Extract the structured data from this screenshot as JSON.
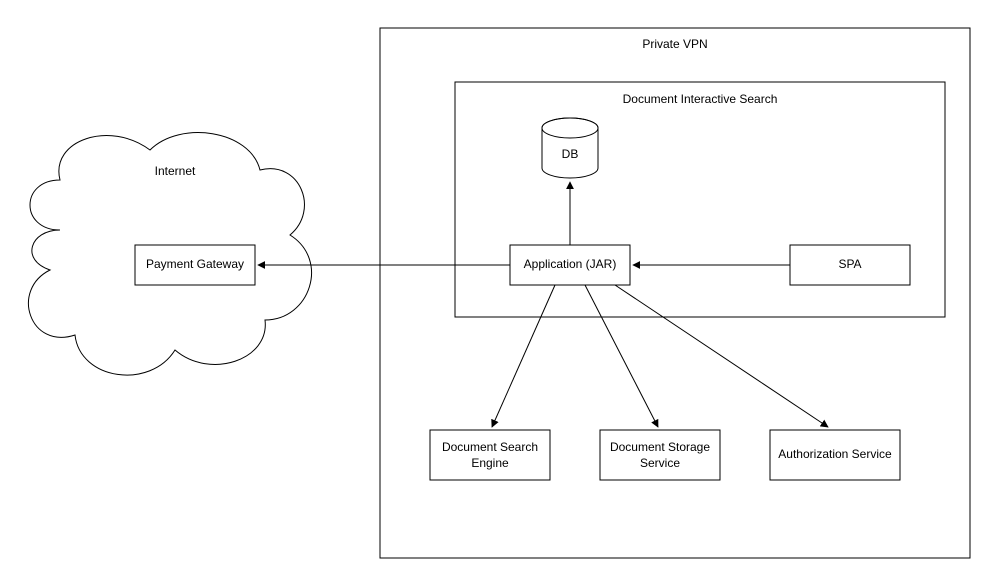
{
  "diagram": {
    "cloud_label": "Internet",
    "payment_gateway": "Payment Gateway",
    "private_vpn": "Private VPN",
    "doc_interactive_search": "Document Interactive Search",
    "db": "DB",
    "application": "Application (JAR)",
    "spa": "SPA",
    "doc_search_engine": "Document Search\nEngine",
    "doc_storage_service": "Document Storage\nService",
    "authorization_service": "Authorization Service"
  }
}
